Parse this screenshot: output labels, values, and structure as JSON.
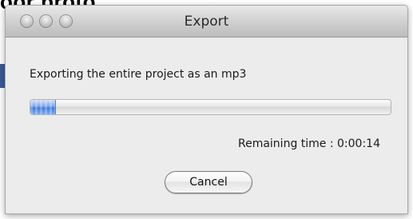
{
  "background": {
    "partial_text": "oor proto"
  },
  "window": {
    "title": "Export"
  },
  "dialog": {
    "message": "Exporting the entire project as an mp3",
    "progress": 0.07,
    "remaining_label": "Remaining time : 0:00:14",
    "cancel_label": "Cancel"
  },
  "colors": {
    "progress_fill": "#3f78dc",
    "window_bg": "#ececec"
  }
}
